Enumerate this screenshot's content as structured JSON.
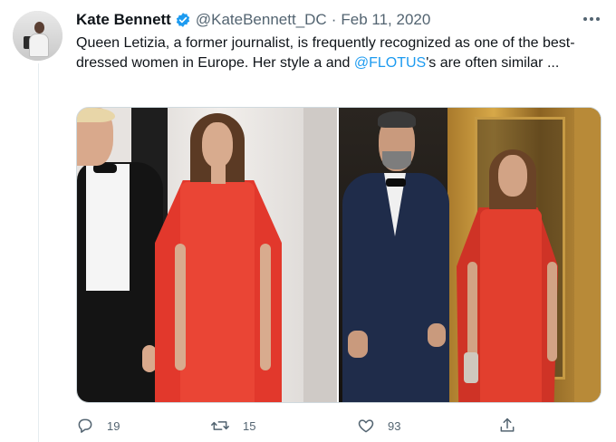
{
  "tweet": {
    "author": {
      "name": "Kate Bennett",
      "handle": "@KateBennett_DC",
      "verified": true
    },
    "separator": "·",
    "date": "Feb 11, 2020",
    "text_before_mention": "Queen Letizia, a former journalist, is frequently recognized as one of the best-dressed women in Europe. Her style a and ",
    "mention": "@FLOTUS",
    "text_after_mention": "'s are often similar ...",
    "media": [
      {
        "icon": "photo-left"
      },
      {
        "icon": "photo-right"
      }
    ],
    "actions": {
      "replies": "19",
      "retweets": "15",
      "likes": "93"
    }
  },
  "colors": {
    "accent": "#1d9bf0",
    "secondary_text": "#536471",
    "primary_text": "#0f1419",
    "dress_red": "#e23f2e"
  }
}
